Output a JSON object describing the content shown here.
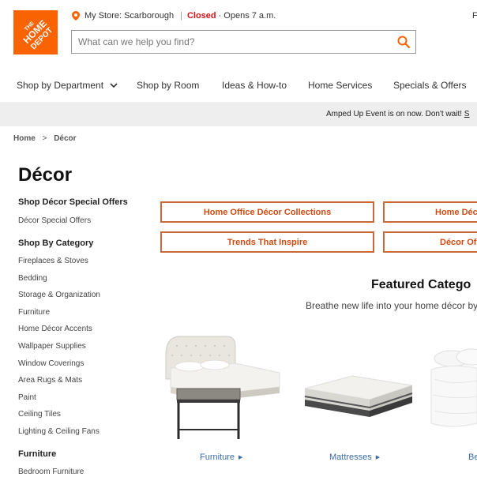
{
  "header": {
    "logo_text": "THE HOME DEPOT",
    "store_label": "My Store:",
    "store_name": "Scarborough",
    "status": "Closed",
    "hours": "Opens 7 a.m.",
    "overflow_letter": "F",
    "search_placeholder": "What can we help you find?"
  },
  "nav": {
    "items": [
      {
        "label": "Shop by Department"
      },
      {
        "label": "Shop by Room"
      },
      {
        "label": "Ideas & How-to"
      },
      {
        "label": "Home Services"
      },
      {
        "label": "Specials & Offers"
      }
    ]
  },
  "promo": {
    "text": "Amped Up Event is on now. Don't wait! ",
    "link": "S"
  },
  "breadcrumb": {
    "home": "Home",
    "separator": ">",
    "current": "Décor"
  },
  "page_title": "Décor",
  "sidebar": {
    "special_heading": "Shop Décor Special Offers",
    "special_link": "Décor Special Offers",
    "category_heading": "Shop By Category",
    "categories": [
      "Fireplaces & Stoves",
      "Bedding",
      "Storage & Organization",
      "Furniture",
      "Home Décor Accents",
      "Wallpaper Supplies",
      "Window Coverings",
      "Area Rugs & Mats",
      "Paint",
      "Ceiling Tiles",
      "Lighting & Ceiling Fans"
    ],
    "furniture_heading": "Furniture",
    "furniture_link": "Bedroom Furniture"
  },
  "buttons": [
    "Home Office Décor Collections",
    "Home Déc",
    "Trends That Inspire",
    "Décor Of"
  ],
  "featured": {
    "title": "Featured Catego",
    "subtitle": "Breathe new life into your home décor by",
    "items": [
      {
        "label": "Furniture"
      },
      {
        "label": "Mattresses"
      },
      {
        "label": "Be"
      }
    ]
  },
  "colors": {
    "brand_orange": "#f96302",
    "closed_red": "#d81118",
    "link_blue": "#3a6ea5"
  }
}
